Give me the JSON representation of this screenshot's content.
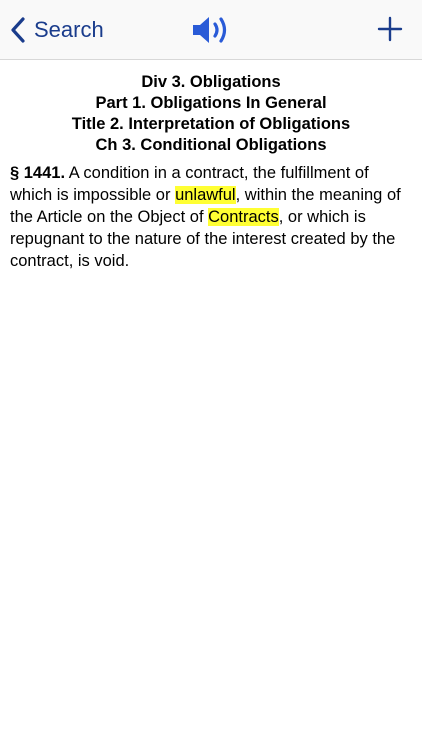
{
  "nav": {
    "back_label": "Search",
    "speaker_icon": "speaker-icon",
    "add_icon": "plus-icon"
  },
  "heading": {
    "division": "Div 3. Obligations",
    "part": "Part 1. Obligations In General",
    "title": "Title 2. Interpretation of Obligations",
    "chapter": "Ch 3. Conditional Obligations"
  },
  "section": {
    "number": "§ 1441.",
    "text_1": " A condition in a contract, the fulfillment of which is impossible or ",
    "highlight_1": "unlawful",
    "text_2": ", within the meaning of the Article on the Object of ",
    "highlight_2": "Contracts",
    "text_3": ", or which is repugnant to the nature of the interest created by the contract, is void."
  },
  "colors": {
    "accent": "#1a3c8c",
    "speaker": "#2a5bd7",
    "highlight": "#ffff33"
  }
}
